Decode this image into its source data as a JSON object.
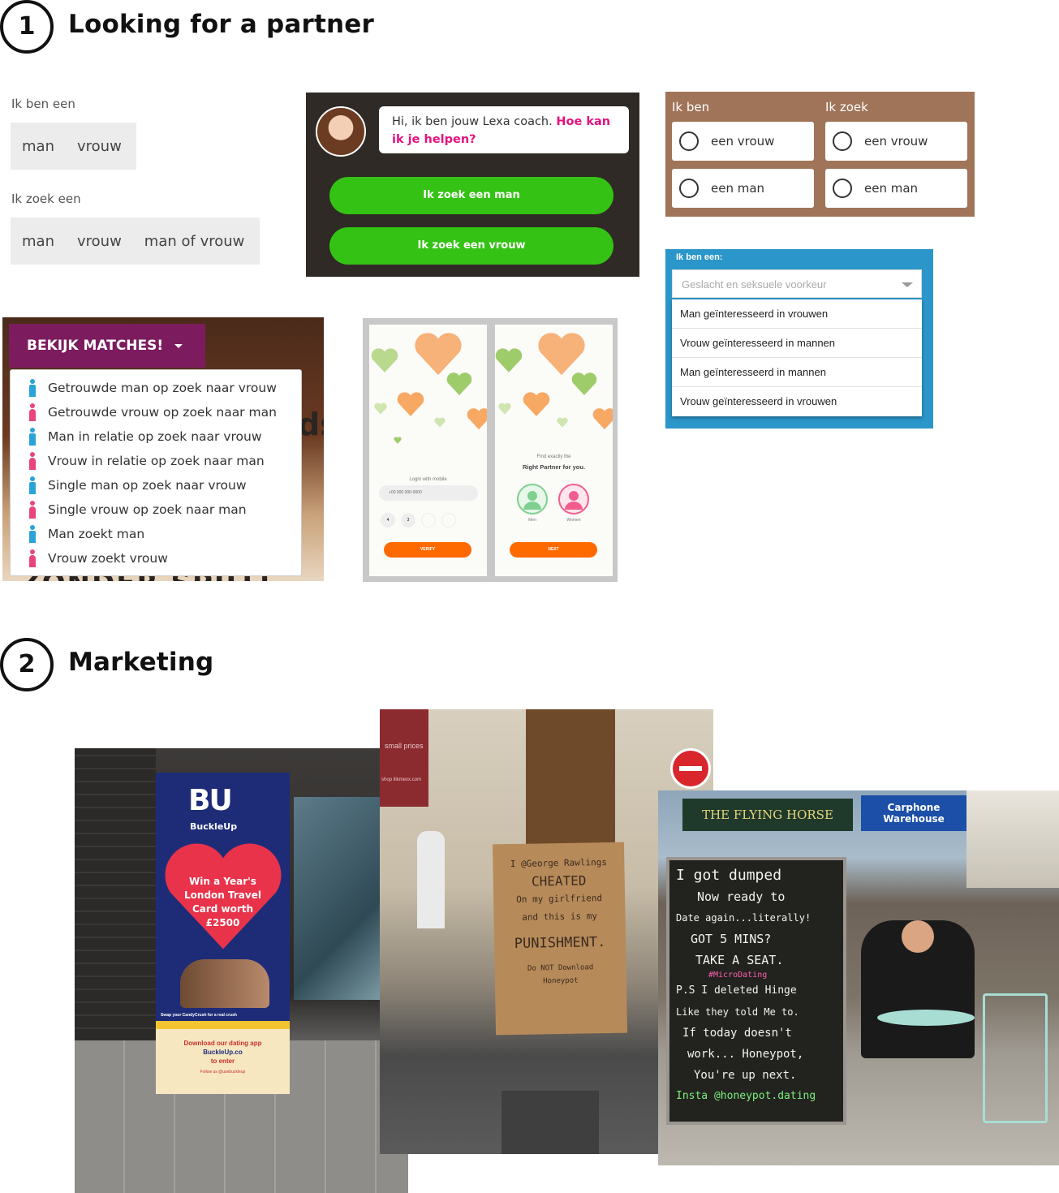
{
  "section1": {
    "number": "1",
    "title": "Looking for a partner"
  },
  "section2": {
    "number": "2",
    "title": "Marketing"
  },
  "panel_grey": {
    "label1": "Ik ben een",
    "options1": [
      "man",
      "vrouw"
    ],
    "label2": "Ik zoek een",
    "options2": [
      "man",
      "vrouw",
      "man of vrouw"
    ]
  },
  "panel_lexa": {
    "bubble_text": "Hi, ik ben jouw Lexa coach. ",
    "bubble_highlight": "Hoe kan ik je helpen?",
    "button1": "Ik zoek een man",
    "button2": "Ik zoek een vrouw"
  },
  "panel_radio": {
    "head_left": "Ik ben",
    "head_right": "Ik zoek",
    "opt_tl": "een vrouw",
    "opt_tr": "een vrouw",
    "opt_bl": "een man",
    "opt_br": "een man"
  },
  "panel_select": {
    "label": "Ik ben een:",
    "placeholder": "Geslacht en seksuele voorkeur",
    "items": [
      "Man geïnteresseerd in vrouwen",
      "Vrouw geïnteresseerd in mannen",
      "Man geïnteresseerd in mannen",
      "Vrouw geïnteresseerd in vrouwen"
    ]
  },
  "panel_matches": {
    "button": "BEKIJK MATCHES!",
    "items": [
      "Getrouwde man op zoek naar vrouw",
      "Getrouwde vrouw op zoek naar man",
      "Man in relatie op zoek naar vrouw",
      "Vrouw in relatie op zoek naar man",
      "Single man op zoek naar vrouw",
      "Single vrouw op zoek naar man",
      "Man zoekt man",
      "Vrouw zoekt vrouw"
    ],
    "ghost_right": "ds",
    "ghost_bottom": "ZONDER SPIJT!"
  },
  "panel_app": {
    "login_label": "Login with mobile",
    "phone_value": "+00 000 000-0000",
    "code_digits": [
      "4",
      "3"
    ],
    "verify": "VERIFY",
    "find_small": "Find exactly the",
    "find_big": "Right Partner for you.",
    "men": "Men",
    "women": "Women",
    "next": "NEXT"
  },
  "photos": {
    "buckleup": {
      "logo": "BU",
      "brand": "BuckleUp",
      "heart_text": [
        "Win a Year's",
        "London Travel",
        "Card worth",
        "£2500"
      ],
      "swap": "Swap your CandyCrush for a real crush",
      "download": [
        "Download our dating app",
        "BuckleUp.co",
        "to enter"
      ],
      "follow": "Follow us @usebuckleup"
    },
    "cardboard": {
      "lines": [
        "I @George Rawlings",
        "CHEATED",
        "On my girlfriend",
        "and this is my",
        "PUNISHMENT.",
        "Do NOT Download",
        "Honeypot"
      ],
      "sign_top": "small prices",
      "sign_sub": "shop ilikmexx.com"
    },
    "chalkboard": {
      "pub": "THE FLYING HORSE",
      "shop": "Carphone Warehouse",
      "lines": [
        "I got dumped",
        "Now ready to",
        "Date again...literally!",
        "GOT 5 MINS?",
        "TAKE A SEAT.",
        "#MicroDating",
        "P.S I deleted Hinge",
        "Like they told Me to.",
        "If today doesn't",
        "work... Honeypot,",
        "You're up next.",
        "Insta @honeypot.dating"
      ]
    }
  },
  "colors": {
    "green": "#34c314",
    "pink": "#e5127e",
    "brown": "#a07458",
    "blue": "#2a96c9",
    "purple": "#7c1b5e",
    "orange": "#ff6a00"
  }
}
